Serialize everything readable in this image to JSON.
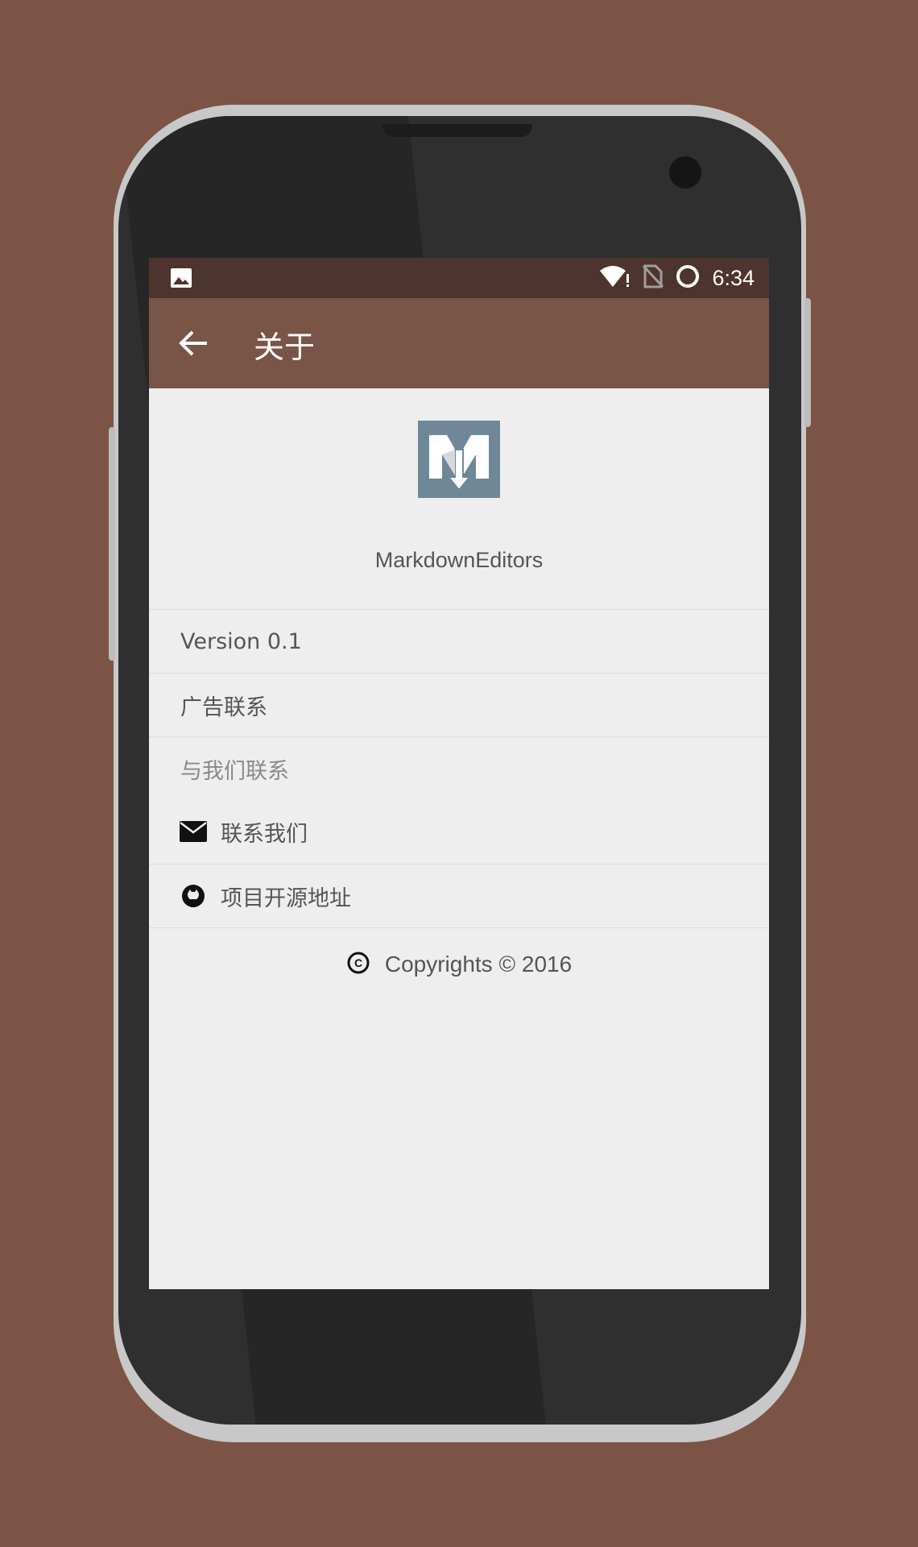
{
  "status_bar": {
    "time": "6:34",
    "icons": [
      "image-notification-icon",
      "wifi-icon",
      "no-sim-icon",
      "sync-circle-icon"
    ]
  },
  "toolbar": {
    "back_icon": "arrow-back-icon",
    "title": "关于"
  },
  "app": {
    "logo_icon": "markdown-m-logo",
    "name": "MarkdownEditors"
  },
  "rows": {
    "version": "Version 0.1",
    "ads_contact": "广告联系",
    "contact_header": "与我们联系",
    "contact_us": "联系我们",
    "project_source": "项目开源地址"
  },
  "footer": {
    "copyright": "Copyrights © 2016"
  },
  "colors": {
    "background": "#7b5446",
    "status_bar": "#4e342e",
    "toolbar": "#795548",
    "screen": "#eeeeee",
    "logo_bg": "#6e8898"
  }
}
